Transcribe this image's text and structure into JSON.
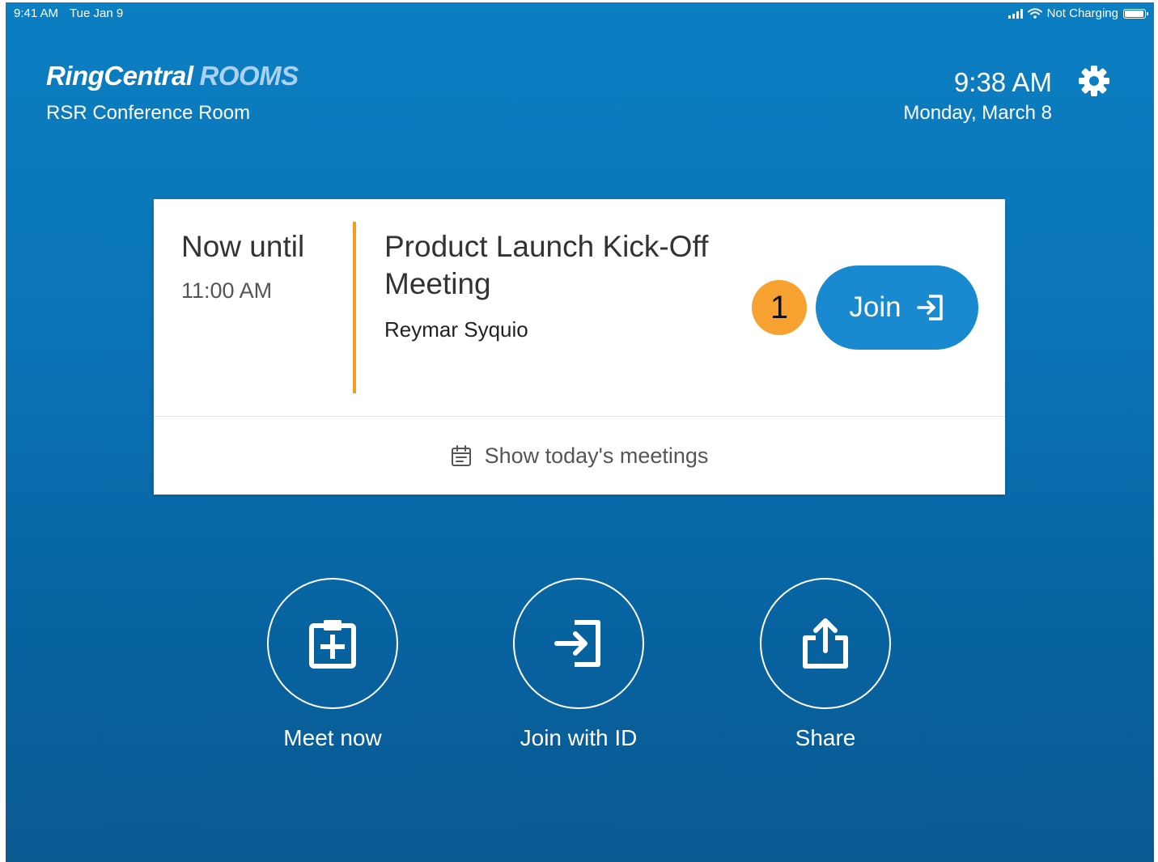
{
  "statusbar": {
    "time": "9:41 AM",
    "date": "Tue Jan 9",
    "charging": "Not Charging"
  },
  "header": {
    "brand": "RingCentral",
    "product": "ROOMS",
    "room_name": "RSR Conference Room",
    "clock": "9:38 AM",
    "date": "Monday, March 8",
    "settings_icon": "gear-icon"
  },
  "meeting_card": {
    "now_label": "Now until",
    "until_time": "11:00 AM",
    "title": "Product Launch Kick-Off Meeting",
    "organizer": "Reymar Syquio",
    "badge_number": "1",
    "join_label": "Join",
    "show_meetings_label": "Show today's meetings",
    "accent_color": "#f39c22"
  },
  "actions": [
    {
      "label": "Meet now",
      "icon": "meet-now-icon"
    },
    {
      "label": "Join with ID",
      "icon": "join-with-id-icon"
    },
    {
      "label": "Share",
      "icon": "share-icon"
    }
  ],
  "colors": {
    "background": "#0a73b5",
    "join_button": "#1a8ad0",
    "badge": "#f7a130"
  }
}
